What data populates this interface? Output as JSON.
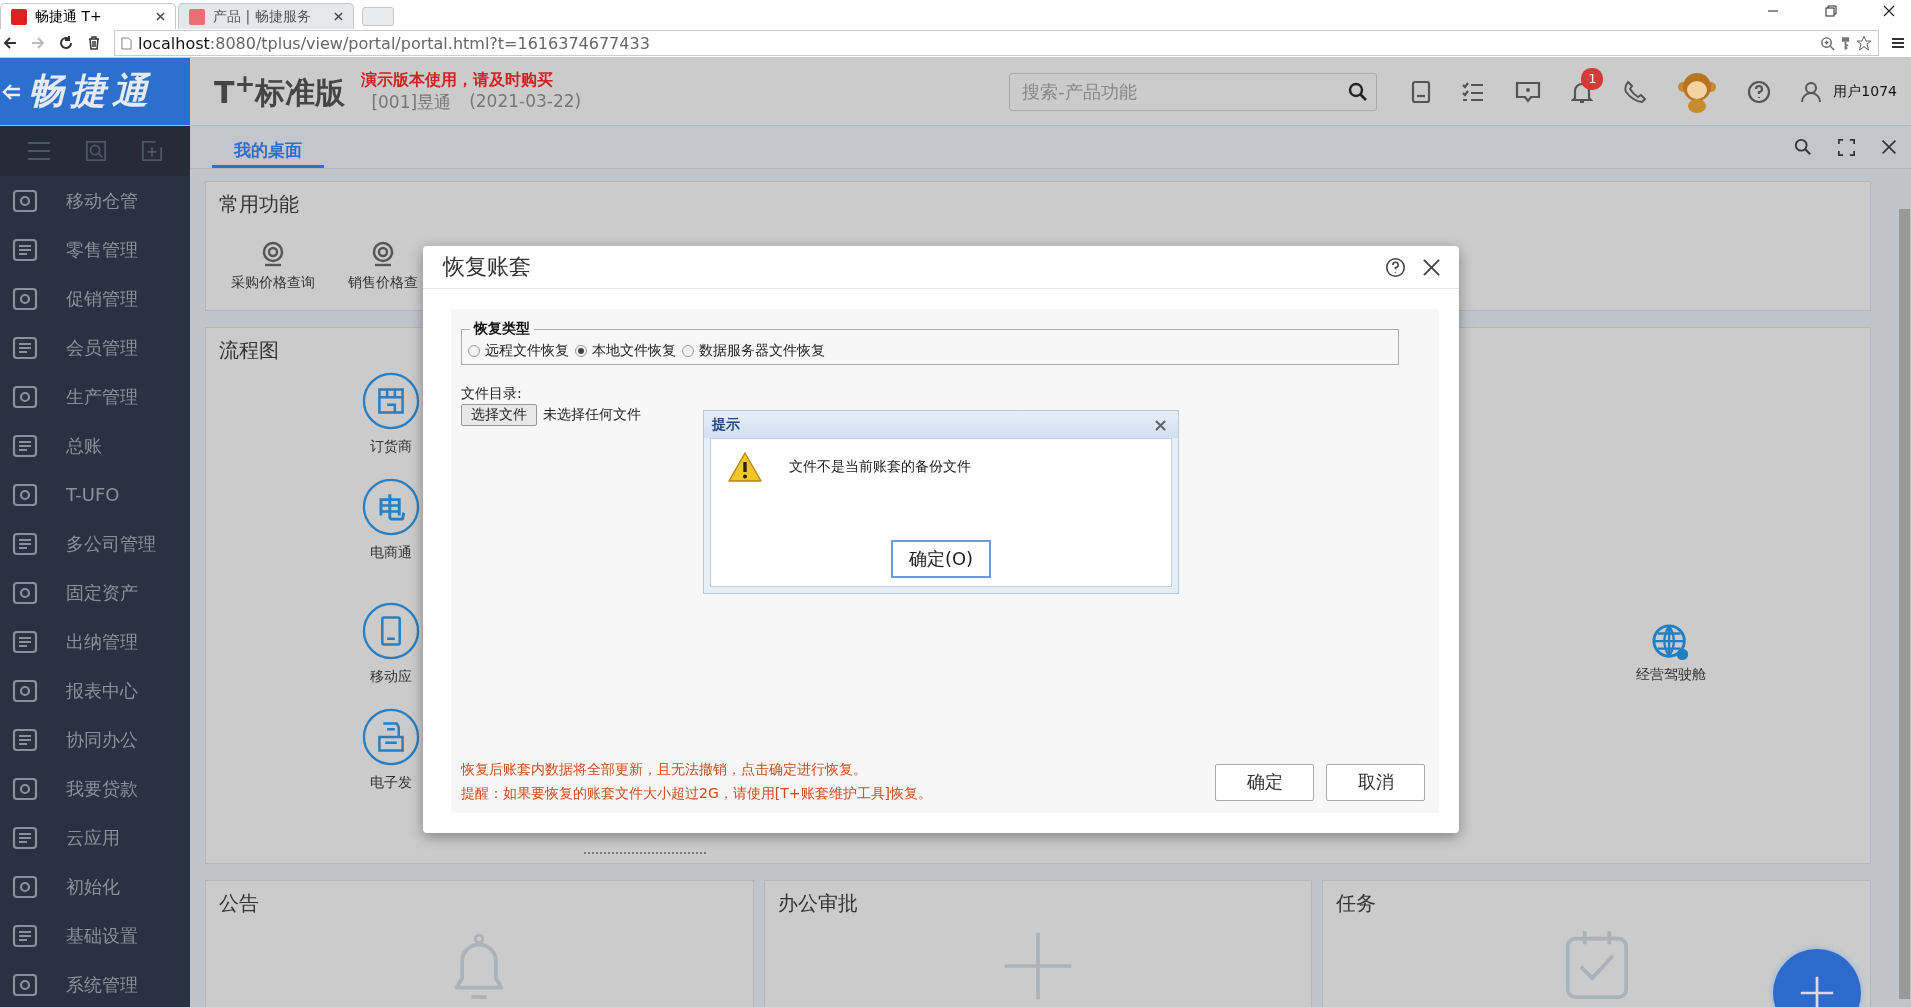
{
  "browser": {
    "tabs": [
      {
        "title": "畅捷通 T+",
        "selected": true
      },
      {
        "title": "产品 | 畅捷服务",
        "selected": false
      }
    ],
    "url_host": "localhost",
    "url_rest": ":8080/tplus/view/portal/portal.html?t=1616374677433"
  },
  "header": {
    "logo": "畅捷通",
    "product": "T$^{+}$标准版",
    "notice": "演示版本使用，请及时购买",
    "account": "[001]昱通",
    "date": "(2021-03-22)",
    "search": {
      "placeholder": "搜索-产品功能"
    },
    "notification_count": "1",
    "user": "用户1074"
  },
  "sidebar": {
    "items": [
      {
        "label": "移动仓管",
        "selected": false
      },
      {
        "label": "零售管理",
        "selected": false
      },
      {
        "label": "促销管理",
        "selected": false
      },
      {
        "label": "会员管理",
        "selected": false
      },
      {
        "label": "生产管理",
        "selected": false
      },
      {
        "label": "总账",
        "selected": false
      },
      {
        "label": "T-UFO",
        "selected": false
      },
      {
        "label": "多公司管理",
        "selected": false
      },
      {
        "label": "固定资产",
        "selected": false
      },
      {
        "label": "出纳管理",
        "selected": false
      },
      {
        "label": "报表中心",
        "selected": false
      },
      {
        "label": "协同办公",
        "selected": false
      },
      {
        "label": "我要贷款",
        "selected": false
      },
      {
        "label": "云应用",
        "selected": false
      },
      {
        "label": "初始化",
        "selected": false
      },
      {
        "label": "基础设置",
        "selected": false
      },
      {
        "label": "系统管理",
        "selected": false
      }
    ]
  },
  "tabs": [
    {
      "label": "我的桌面",
      "selected": true
    }
  ],
  "common": {
    "title": "常用功能",
    "items": [
      "采购价格查询",
      "销售价格查"
    ]
  },
  "flow": {
    "title": "流程图",
    "nodes": [
      {
        "label": "订货商",
        "kind": "store"
      },
      {
        "label": "电商通",
        "kind": "char",
        "glyph": "电"
      },
      {
        "label": "移动应",
        "kind": "phone"
      },
      {
        "label": "电子发",
        "kind": "printer"
      }
    ],
    "cockpit": "经营驾驶舱"
  },
  "bottom_cards": [
    {
      "title": "公告",
      "kind": "bell"
    },
    {
      "title": "办公审批",
      "kind": "plus"
    },
    {
      "title": "任务",
      "kind": "task"
    }
  ],
  "dialog": {
    "title": "恢复账套",
    "legend": "恢复类型",
    "options": [
      {
        "label": "远程文件恢复",
        "selected": false
      },
      {
        "label": "本地文件恢复",
        "selected": true
      },
      {
        "label": "数据服务器文件恢复",
        "selected": false
      }
    ],
    "dir_label": "文件目录:",
    "choose_button": "选择文件",
    "no_file": "未选择任何文件",
    "notes": [
      "恢复后账套内数据将全部更新，且无法撤销，点击确定进行恢复。",
      "提醒：如果要恢复的账套文件大小超过2G，请使用[T+账套维护工具]恢复。"
    ],
    "buttons": [
      "确定",
      "取消"
    ]
  },
  "alert": {
    "title": "提示",
    "close": "×",
    "message": "文件不是当前账套的备份文件",
    "button": "确定(O)"
  }
}
